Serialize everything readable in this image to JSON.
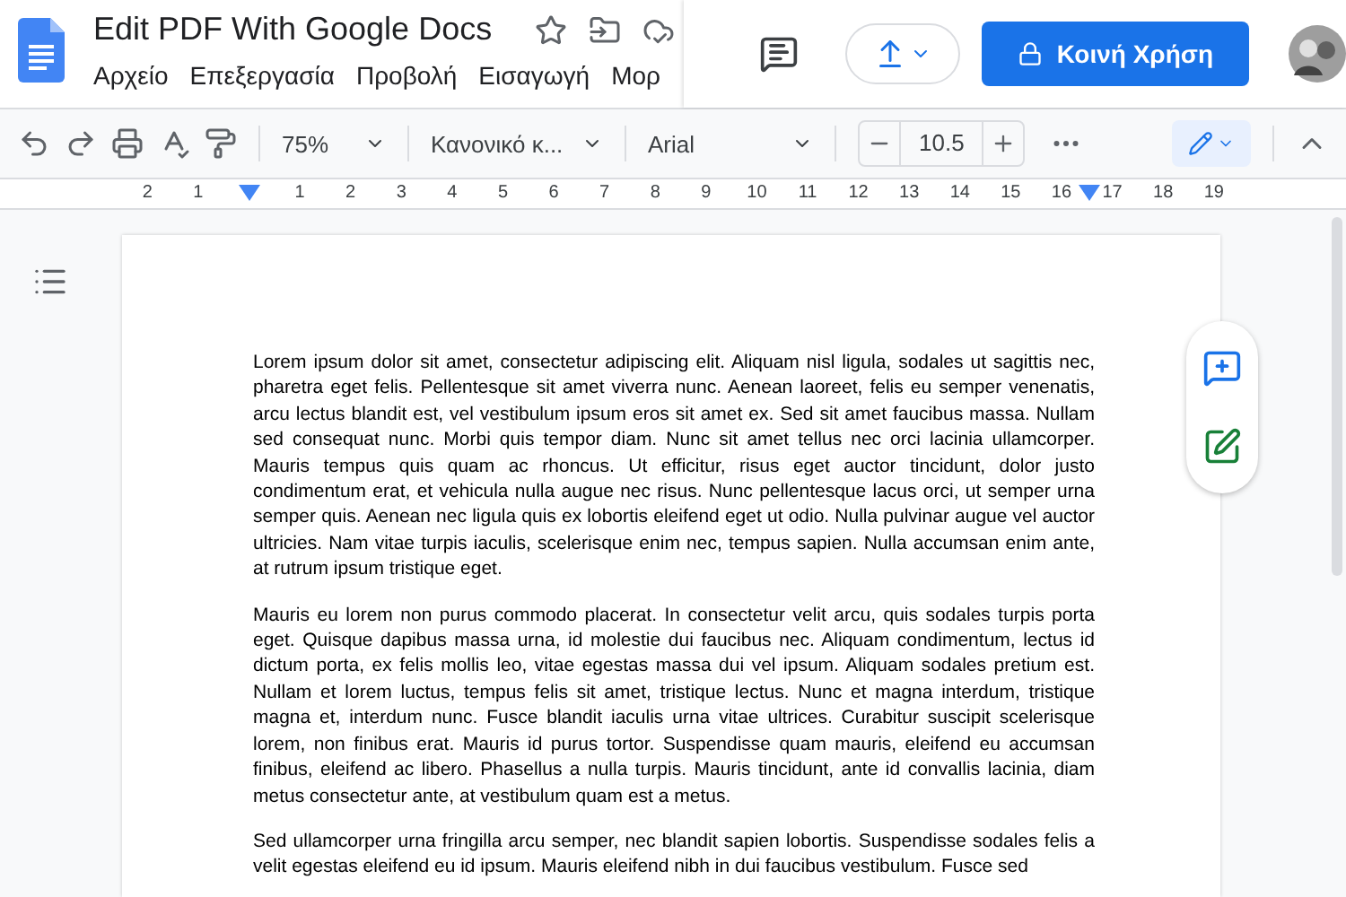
{
  "document": {
    "title": "Edit PDF With Google Docs",
    "starred": false
  },
  "menus": [
    {
      "label": "Αρχείο"
    },
    {
      "label": "Επεξεργασία"
    },
    {
      "label": "Προβολή"
    },
    {
      "label": "Εισαγωγή"
    },
    {
      "label": "Μορ"
    }
  ],
  "share_button": {
    "label": "Κοινή Χρήση"
  },
  "toolbar": {
    "zoom": "75%",
    "style": "Κανονικό κ...",
    "font": "Arial",
    "font_size": "10.5",
    "editing_mode_selected": true
  },
  "ruler": {
    "left_labels": [
      "2",
      "1"
    ],
    "right_labels": [
      "1",
      "2",
      "3",
      "4",
      "5",
      "6",
      "7",
      "8",
      "9",
      "10",
      "11",
      "12",
      "13",
      "14",
      "15",
      "16",
      "17",
      "18",
      "19"
    ]
  },
  "paragraphs": [
    "Lorem ipsum dolor sit amet, consectetur adipiscing elit. Aliquam nisl ligula, sodales ut sagittis  nec, pharetra eget felis. Pellentesque sit amet viverra nunc. Aenean laoreet, felis eu semper  venenatis, arcu lectus blandit est, vel vestibulum ipsum eros sit amet ex. Sed sit amet faucibus  massa. Nullam sed consequat nunc. Morbi quis tempor diam. Nunc sit amet tellus nec orci lacinia  ullamcorper. Mauris tempus quis quam ac rhoncus. Ut efficitur, risus eget auctor tincidunt, dolor  justo condimentum erat, et vehicula nulla augue nec risus. Nunc pellentesque lacus orci, ut  semper urna semper quis. Aenean nec ligula quis ex lobortis eleifend eget ut odio. Nulla pulvinar  augue vel auctor ultricies. Nam vitae turpis iaculis, scelerisque enim nec, tempus sapien. Nulla  accumsan enim ante, at rutrum ipsum tristique eget.",
    "Mauris eu lorem non purus commodo placerat. In consectetur velit arcu, quis sodales turpis  porta eget. Quisque dapibus massa urna, id molestie dui faucibus nec. Aliquam condimentum,  lectus id dictum porta, ex felis mollis leo, vitae egestas massa dui vel ipsum. Aliquam sodales  pretium est. Nullam et lorem luctus, tempus felis sit amet, tristique lectus. Nunc et magna  interdum, tristique magna et, interdum nunc. Fusce blandit iaculis urna vitae ultrices. Curabitur  suscipit scelerisque lorem, non finibus erat. Mauris id purus tortor. Suspendisse quam mauris,  eleifend eu accumsan finibus, eleifend ac libero. Phasellus a nulla turpis. Mauris tincidunt, ante  id convallis lacinia, diam metus consectetur ante, at vestibulum quam est a metus.",
    "Sed ullamcorper urna fringilla arcu semper, nec blandit sapien lobortis. Suspendisse sodales felis  a velit egestas eleifend eu id ipsum. Mauris eleifend nibh in dui faucibus vestibulum. Fusce sed"
  ]
}
